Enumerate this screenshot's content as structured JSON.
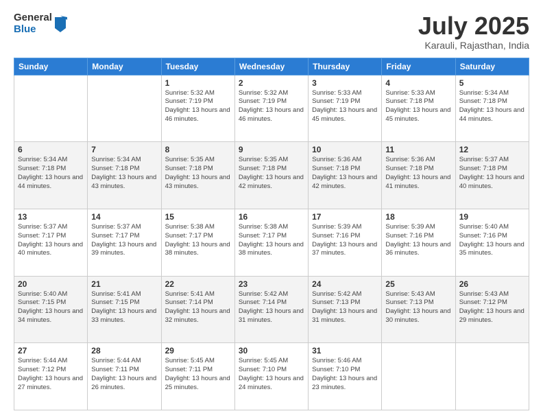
{
  "logo": {
    "general": "General",
    "blue": "Blue"
  },
  "title": "July 2025",
  "subtitle": "Karauli, Rajasthan, India",
  "headers": [
    "Sunday",
    "Monday",
    "Tuesday",
    "Wednesday",
    "Thursday",
    "Friday",
    "Saturday"
  ],
  "weeks": [
    [
      {
        "day": "",
        "sunrise": "",
        "sunset": "",
        "daylight": ""
      },
      {
        "day": "",
        "sunrise": "",
        "sunset": "",
        "daylight": ""
      },
      {
        "day": "1",
        "sunrise": "Sunrise: 5:32 AM",
        "sunset": "Sunset: 7:19 PM",
        "daylight": "Daylight: 13 hours and 46 minutes."
      },
      {
        "day": "2",
        "sunrise": "Sunrise: 5:32 AM",
        "sunset": "Sunset: 7:19 PM",
        "daylight": "Daylight: 13 hours and 46 minutes."
      },
      {
        "day": "3",
        "sunrise": "Sunrise: 5:33 AM",
        "sunset": "Sunset: 7:19 PM",
        "daylight": "Daylight: 13 hours and 45 minutes."
      },
      {
        "day": "4",
        "sunrise": "Sunrise: 5:33 AM",
        "sunset": "Sunset: 7:18 PM",
        "daylight": "Daylight: 13 hours and 45 minutes."
      },
      {
        "day": "5",
        "sunrise": "Sunrise: 5:34 AM",
        "sunset": "Sunset: 7:18 PM",
        "daylight": "Daylight: 13 hours and 44 minutes."
      }
    ],
    [
      {
        "day": "6",
        "sunrise": "Sunrise: 5:34 AM",
        "sunset": "Sunset: 7:18 PM",
        "daylight": "Daylight: 13 hours and 44 minutes."
      },
      {
        "day": "7",
        "sunrise": "Sunrise: 5:34 AM",
        "sunset": "Sunset: 7:18 PM",
        "daylight": "Daylight: 13 hours and 43 minutes."
      },
      {
        "day": "8",
        "sunrise": "Sunrise: 5:35 AM",
        "sunset": "Sunset: 7:18 PM",
        "daylight": "Daylight: 13 hours and 43 minutes."
      },
      {
        "day": "9",
        "sunrise": "Sunrise: 5:35 AM",
        "sunset": "Sunset: 7:18 PM",
        "daylight": "Daylight: 13 hours and 42 minutes."
      },
      {
        "day": "10",
        "sunrise": "Sunrise: 5:36 AM",
        "sunset": "Sunset: 7:18 PM",
        "daylight": "Daylight: 13 hours and 42 minutes."
      },
      {
        "day": "11",
        "sunrise": "Sunrise: 5:36 AM",
        "sunset": "Sunset: 7:18 PM",
        "daylight": "Daylight: 13 hours and 41 minutes."
      },
      {
        "day": "12",
        "sunrise": "Sunrise: 5:37 AM",
        "sunset": "Sunset: 7:18 PM",
        "daylight": "Daylight: 13 hours and 40 minutes."
      }
    ],
    [
      {
        "day": "13",
        "sunrise": "Sunrise: 5:37 AM",
        "sunset": "Sunset: 7:17 PM",
        "daylight": "Daylight: 13 hours and 40 minutes."
      },
      {
        "day": "14",
        "sunrise": "Sunrise: 5:37 AM",
        "sunset": "Sunset: 7:17 PM",
        "daylight": "Daylight: 13 hours and 39 minutes."
      },
      {
        "day": "15",
        "sunrise": "Sunrise: 5:38 AM",
        "sunset": "Sunset: 7:17 PM",
        "daylight": "Daylight: 13 hours and 38 minutes."
      },
      {
        "day": "16",
        "sunrise": "Sunrise: 5:38 AM",
        "sunset": "Sunset: 7:17 PM",
        "daylight": "Daylight: 13 hours and 38 minutes."
      },
      {
        "day": "17",
        "sunrise": "Sunrise: 5:39 AM",
        "sunset": "Sunset: 7:16 PM",
        "daylight": "Daylight: 13 hours and 37 minutes."
      },
      {
        "day": "18",
        "sunrise": "Sunrise: 5:39 AM",
        "sunset": "Sunset: 7:16 PM",
        "daylight": "Daylight: 13 hours and 36 minutes."
      },
      {
        "day": "19",
        "sunrise": "Sunrise: 5:40 AM",
        "sunset": "Sunset: 7:16 PM",
        "daylight": "Daylight: 13 hours and 35 minutes."
      }
    ],
    [
      {
        "day": "20",
        "sunrise": "Sunrise: 5:40 AM",
        "sunset": "Sunset: 7:15 PM",
        "daylight": "Daylight: 13 hours and 34 minutes."
      },
      {
        "day": "21",
        "sunrise": "Sunrise: 5:41 AM",
        "sunset": "Sunset: 7:15 PM",
        "daylight": "Daylight: 13 hours and 33 minutes."
      },
      {
        "day": "22",
        "sunrise": "Sunrise: 5:41 AM",
        "sunset": "Sunset: 7:14 PM",
        "daylight": "Daylight: 13 hours and 32 minutes."
      },
      {
        "day": "23",
        "sunrise": "Sunrise: 5:42 AM",
        "sunset": "Sunset: 7:14 PM",
        "daylight": "Daylight: 13 hours and 31 minutes."
      },
      {
        "day": "24",
        "sunrise": "Sunrise: 5:42 AM",
        "sunset": "Sunset: 7:13 PM",
        "daylight": "Daylight: 13 hours and 31 minutes."
      },
      {
        "day": "25",
        "sunrise": "Sunrise: 5:43 AM",
        "sunset": "Sunset: 7:13 PM",
        "daylight": "Daylight: 13 hours and 30 minutes."
      },
      {
        "day": "26",
        "sunrise": "Sunrise: 5:43 AM",
        "sunset": "Sunset: 7:12 PM",
        "daylight": "Daylight: 13 hours and 29 minutes."
      }
    ],
    [
      {
        "day": "27",
        "sunrise": "Sunrise: 5:44 AM",
        "sunset": "Sunset: 7:12 PM",
        "daylight": "Daylight: 13 hours and 27 minutes."
      },
      {
        "day": "28",
        "sunrise": "Sunrise: 5:44 AM",
        "sunset": "Sunset: 7:11 PM",
        "daylight": "Daylight: 13 hours and 26 minutes."
      },
      {
        "day": "29",
        "sunrise": "Sunrise: 5:45 AM",
        "sunset": "Sunset: 7:11 PM",
        "daylight": "Daylight: 13 hours and 25 minutes."
      },
      {
        "day": "30",
        "sunrise": "Sunrise: 5:45 AM",
        "sunset": "Sunset: 7:10 PM",
        "daylight": "Daylight: 13 hours and 24 minutes."
      },
      {
        "day": "31",
        "sunrise": "Sunrise: 5:46 AM",
        "sunset": "Sunset: 7:10 PM",
        "daylight": "Daylight: 13 hours and 23 minutes."
      },
      {
        "day": "",
        "sunrise": "",
        "sunset": "",
        "daylight": ""
      },
      {
        "day": "",
        "sunrise": "",
        "sunset": "",
        "daylight": ""
      }
    ]
  ]
}
